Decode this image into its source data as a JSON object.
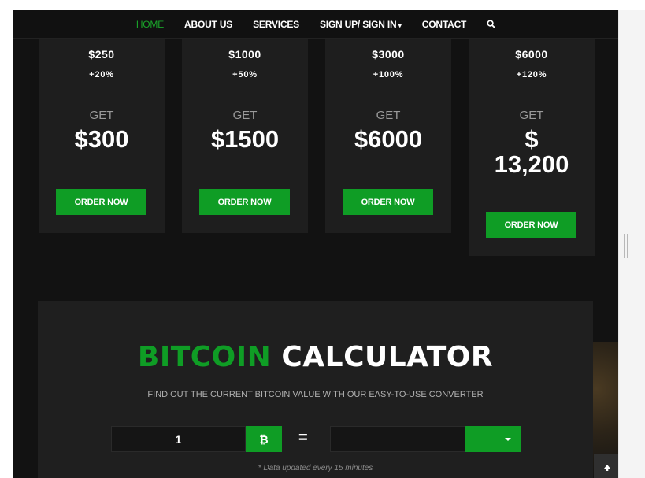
{
  "nav": {
    "items": [
      {
        "label": "HOME",
        "active": true
      },
      {
        "label": "ABOUT US",
        "active": false
      },
      {
        "label": "SERVICES",
        "active": false
      },
      {
        "label": "SIGN UP/ SIGN IN",
        "active": false,
        "dropdown": true
      },
      {
        "label": "CONTACT",
        "active": false
      }
    ],
    "search_icon": "search-icon",
    "caret": "▾"
  },
  "plans": [
    {
      "deposit": "$250",
      "percent": "+20%",
      "get_label": "GET",
      "amount": "$300",
      "button": "ORDER NOW"
    },
    {
      "deposit": "$1000",
      "percent": "+50%",
      "get_label": "GET",
      "amount": "$1500",
      "button": "ORDER NOW"
    },
    {
      "deposit": "$3000",
      "percent": "+100%",
      "get_label": "GET",
      "amount": "$6000",
      "button": "ORDER NOW"
    },
    {
      "deposit": "$6000",
      "percent": "+120%",
      "get_label": "GET",
      "amount_line1": "$",
      "amount_line2": "13,200",
      "button": "ORDER NOW"
    }
  ],
  "calculator": {
    "title_green": "BITCOIN",
    "title_white": "CALCULATOR",
    "subtitle": "FIND OUT THE CURRENT BITCOIN VALUE WITH OUR EASY-TO-USE CONVERTER",
    "amount_value": "1",
    "currency_symbol": "₿",
    "equals": "=",
    "result_value": "",
    "note": "* Data updated every 15 minutes"
  },
  "colors": {
    "accent": "#0f9d25",
    "nav_active": "#1aa32a",
    "background": "#121212",
    "card": "#1e1e1e"
  },
  "icons": {
    "scroll_top": "arrow-up-icon",
    "select": "caret-down-icon"
  }
}
